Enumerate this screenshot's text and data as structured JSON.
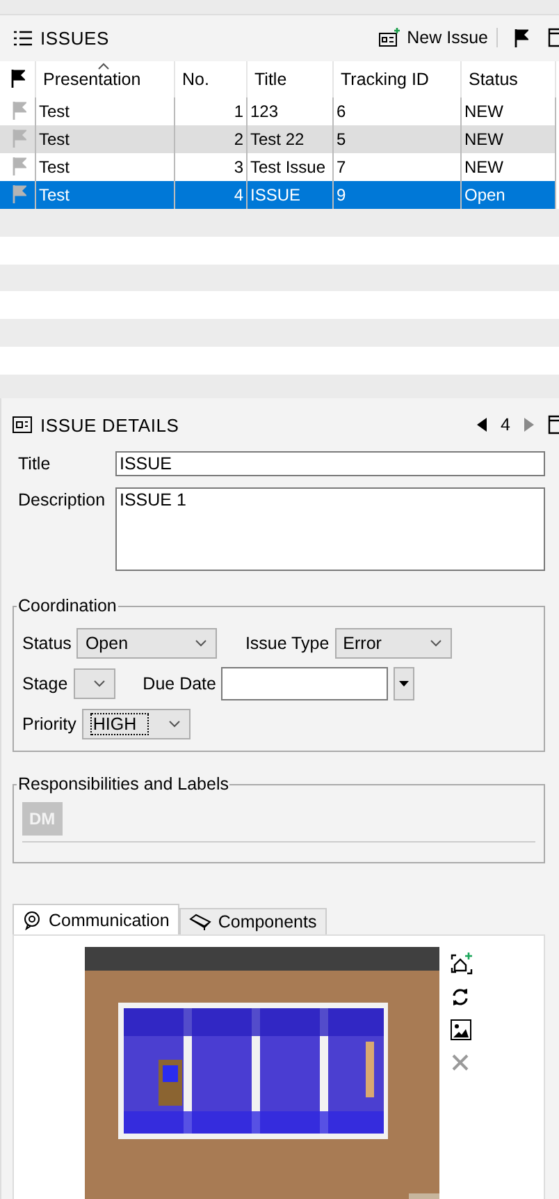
{
  "issues_panel": {
    "title": "ISSUES",
    "new_issue_button": "New Issue",
    "columns": [
      "Presentation",
      "No.",
      "Title",
      "Tracking ID",
      "Status"
    ],
    "rows": [
      {
        "presentation": "Test",
        "no": "1",
        "title": "123",
        "tracking_id": "6",
        "status": "NEW",
        "selected": false,
        "hovered": false
      },
      {
        "presentation": "Test",
        "no": "2",
        "title": "Test 22",
        "tracking_id": "5",
        "status": "NEW",
        "selected": false,
        "hovered": true
      },
      {
        "presentation": "Test",
        "no": "3",
        "title": "Test Issue",
        "tracking_id": "7",
        "status": "NEW",
        "selected": false,
        "hovered": false
      },
      {
        "presentation": "Test",
        "no": "4",
        "title": "ISSUE",
        "tracking_id": "9",
        "status": "Open",
        "selected": true,
        "hovered": false
      }
    ]
  },
  "details_panel": {
    "title": "ISSUE DETAILS",
    "page": "4",
    "title_label": "Title",
    "title_value": "ISSUE",
    "description_label": "Description",
    "description_value": "ISSUE 1",
    "coordination": {
      "legend": "Coordination",
      "status_label": "Status",
      "status_value": "Open",
      "issue_type_label": "Issue Type",
      "issue_type_value": "Error",
      "stage_label": "Stage",
      "due_date_label": "Due Date",
      "priority_label": "Priority",
      "priority_value": "HIGH"
    },
    "responsibilities": {
      "legend": "Responsibilities and Labels",
      "tags": [
        "DM"
      ]
    },
    "tabs": [
      {
        "label": "Communication",
        "selected": true
      },
      {
        "label": "Components",
        "selected": false
      }
    ]
  }
}
